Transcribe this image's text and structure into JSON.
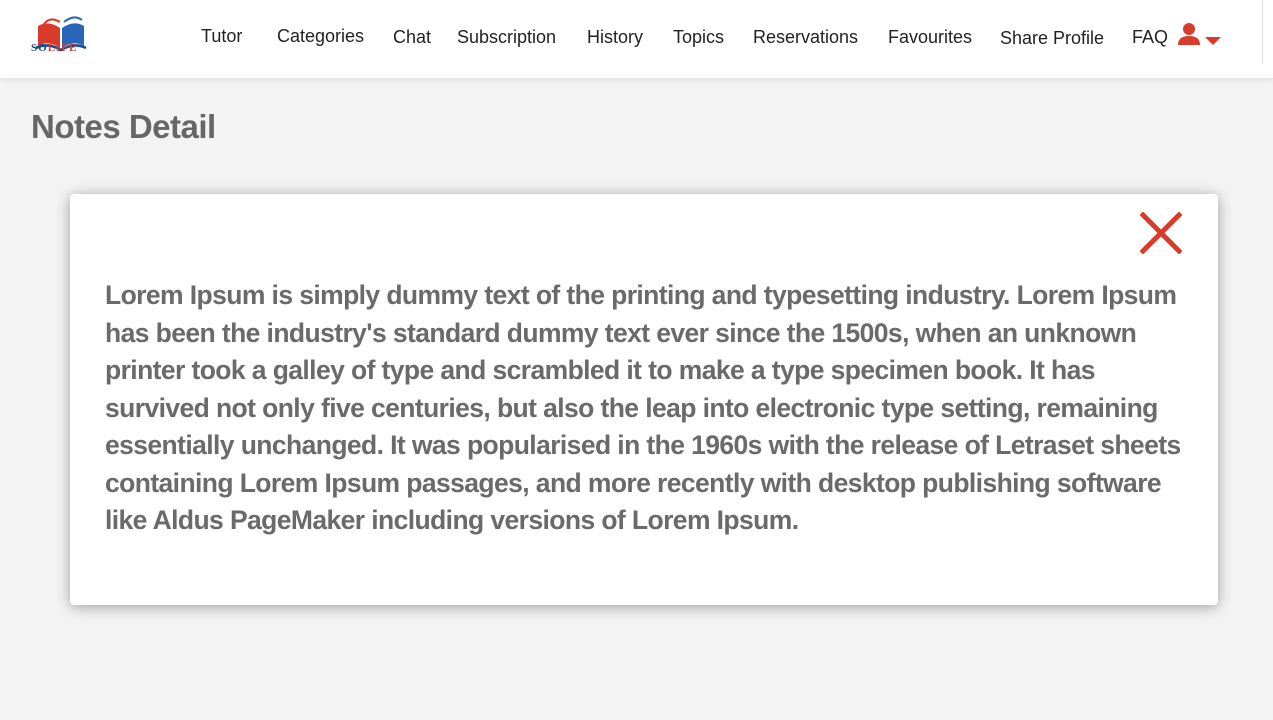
{
  "brand": {
    "logo_so": "SO",
    "logo_life": "LIFE"
  },
  "nav": {
    "items": [
      {
        "label": "Tutor"
      },
      {
        "label": "Categories"
      },
      {
        "label": "Chat"
      },
      {
        "label": "Subscription"
      },
      {
        "label": "History"
      },
      {
        "label": "Topics"
      },
      {
        "label": "Reservations"
      },
      {
        "label": "Favourites"
      },
      {
        "label": "Share Profile"
      },
      {
        "label": "FAQ"
      }
    ],
    "user_icon": "user-icon",
    "dropdown_icon": "caret-down-icon"
  },
  "page": {
    "title": "Notes Detail"
  },
  "note": {
    "close_icon": "close-icon",
    "body": "Lorem Ipsum is simply dummy text of the printing and typesetting industry. Lorem Ipsum has been the industry's standard dummy text ever since the 1500s, when an unknown printer took a galley of type and scrambled it to make a type specimen book. It has survived not only five centuries, but also the leap into electronic type setting, remaining essentially unchanged. It was popularised in the 1960s with the release of Letraset sheets containing Lorem Ipsum passages, and more recently with desktop publishing software like Aldus PageMaker including versions of Lorem Ipsum."
  },
  "colors": {
    "accent": "#d93b2b",
    "brand_blue": "#1a4a8c",
    "text_gray": "#666666",
    "background": "#f3f3f3"
  }
}
